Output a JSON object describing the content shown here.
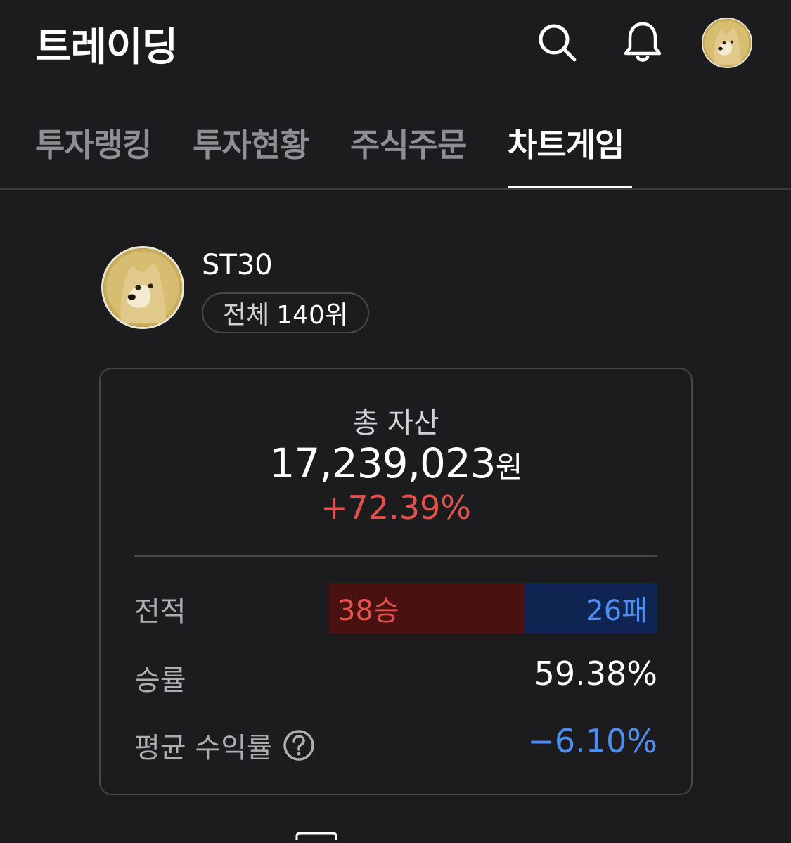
{
  "header": {
    "title": "트레이딩",
    "icons": [
      "search-icon",
      "bell-icon",
      "profile-avatar"
    ]
  },
  "tabs": [
    {
      "label": "투자랭킹",
      "active": false
    },
    {
      "label": "투자현황",
      "active": false
    },
    {
      "label": "주식주문",
      "active": false
    },
    {
      "label": "차트게임",
      "active": true
    }
  ],
  "profile": {
    "name": "ST30",
    "rank_scope": "전체",
    "rank_value": "140위"
  },
  "summary": {
    "total_asset_label": "총 자산",
    "total_asset_value": "17,239,023",
    "total_asset_unit": "원",
    "total_change": "+72.39%",
    "record_label": "전적",
    "wins": "38승",
    "losses": "26패",
    "wins_count": 38,
    "losses_count": 26,
    "win_rate_label": "승률",
    "win_rate_value": "59.38%",
    "avg_return_label": "평균 수익률",
    "avg_return_value": "−6.10%"
  },
  "colors": {
    "background": "#1c1c1e",
    "positive": "#e2524d",
    "negative": "#4d8ef0",
    "win_bar": "#4a1111",
    "loss_bar": "#0f2451"
  }
}
